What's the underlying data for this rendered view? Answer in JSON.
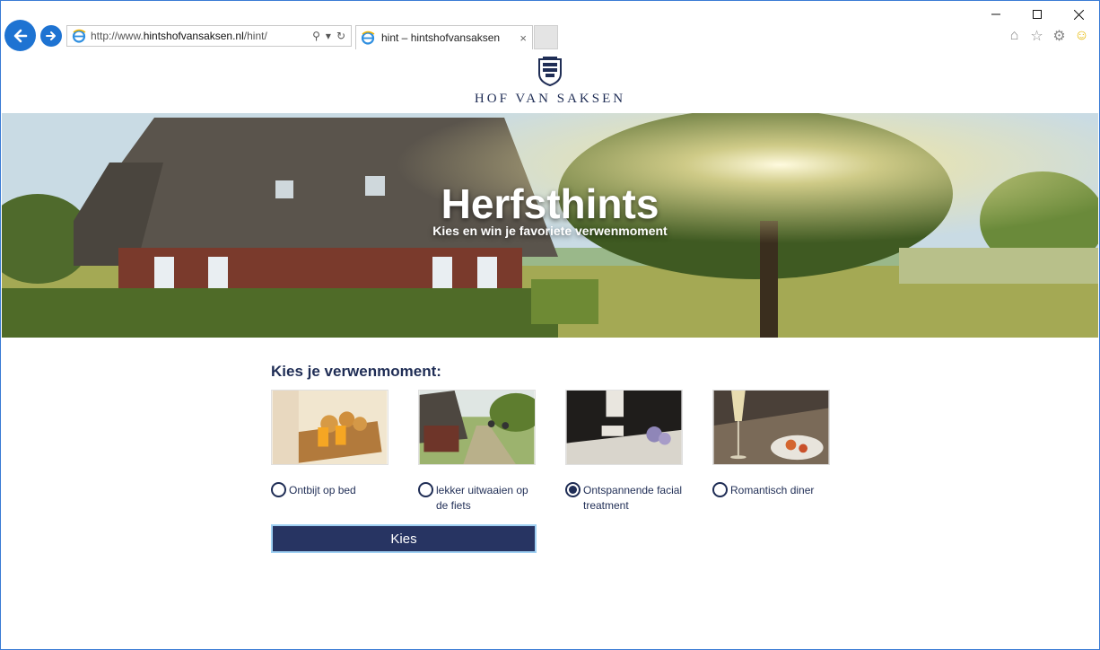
{
  "browser": {
    "url_prefix": "http://www.",
    "url_domain": "hintshofvansaksen.nl",
    "url_path": "/hint/",
    "tab_title": "hint – hintshofvansaksen",
    "tab_close": "×"
  },
  "logo": {
    "brand": "HOF VAN SAKSEN"
  },
  "hero": {
    "title": "Herfsthints",
    "subtitle": "Kies en win je favoriete verwenmoment"
  },
  "form": {
    "question": "Kies je verwenmoment:",
    "options": [
      {
        "label": "Ontbijt op bed",
        "checked": false
      },
      {
        "label": "lekker uitwaaien op de fiets",
        "checked": false
      },
      {
        "label": "Ontspannende facial treatment",
        "checked": true
      },
      {
        "label": "Romantisch diner",
        "checked": false
      }
    ],
    "submit_label": "Kies"
  },
  "colors": {
    "accent": "#1f2d55",
    "button": "#273462",
    "ie_blue": "#1e73d2"
  }
}
